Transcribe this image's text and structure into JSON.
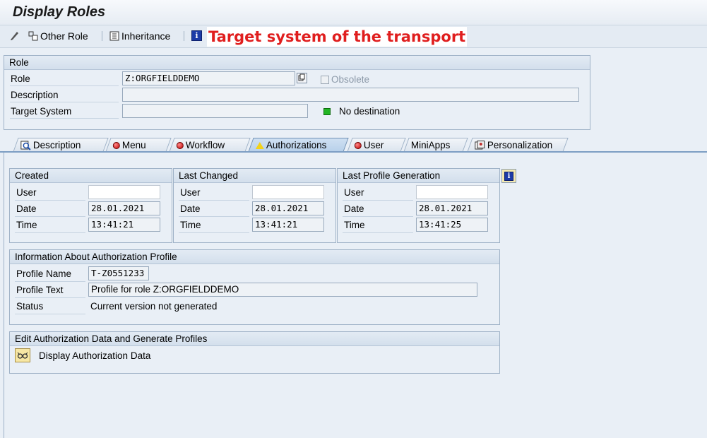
{
  "window": {
    "title": "Display Roles"
  },
  "toolbar": {
    "other_role": "Other Role",
    "inheritance": "Inheritance",
    "annotation": "Target system of the transport"
  },
  "role_group": {
    "title": "Role",
    "role_label": "Role",
    "role_value": "Z:ORGFIELDDEMO",
    "obsolete_label": "Obsolete",
    "description_label": "Description",
    "description_value": "",
    "target_label": "Target System",
    "target_value": "",
    "target_status": "No destination"
  },
  "tabs": [
    {
      "label": "Description",
      "icon": "magnifier-icon"
    },
    {
      "label": "Menu",
      "icon": "red-status-icon"
    },
    {
      "label": "Workflow",
      "icon": "red-status-icon"
    },
    {
      "label": "Authorizations",
      "icon": "yellow-warning-icon"
    },
    {
      "label": "User",
      "icon": "red-status-icon"
    },
    {
      "label": "MiniApps",
      "icon": ""
    },
    {
      "label": "Personalization",
      "icon": "personalization-icon"
    }
  ],
  "created": {
    "title": "Created",
    "user_label": "User",
    "user_value": "",
    "date_label": "Date",
    "date_value": "28.01.2021",
    "time_label": "Time",
    "time_value": "13:41:21"
  },
  "changed": {
    "title": "Last Changed",
    "user_label": "User",
    "user_value": "",
    "date_label": "Date",
    "date_value": "28.01.2021",
    "time_label": "Time",
    "time_value": "13:41:21"
  },
  "profile_gen": {
    "title": "Last Profile Generation",
    "user_label": "User",
    "user_value": "",
    "date_label": "Date",
    "date_value": "28.01.2021",
    "time_label": "Time",
    "time_value": "13:41:25"
  },
  "profile_info": {
    "title": "Information About Authorization Profile",
    "name_label": "Profile Name",
    "name_value": "T-Z0551233",
    "text_label": "Profile Text",
    "text_value": "Profile for role Z:ORGFIELDDEMO",
    "status_label": "Status",
    "status_value": "Current version not generated"
  },
  "edit_auth": {
    "title": "Edit Authorization Data and Generate Profiles",
    "display_label": "Display Authorization Data"
  },
  "colors": {
    "annotation": "#e01e1e",
    "active_tab": "#b7d0ea",
    "background": "#e9eff6"
  }
}
